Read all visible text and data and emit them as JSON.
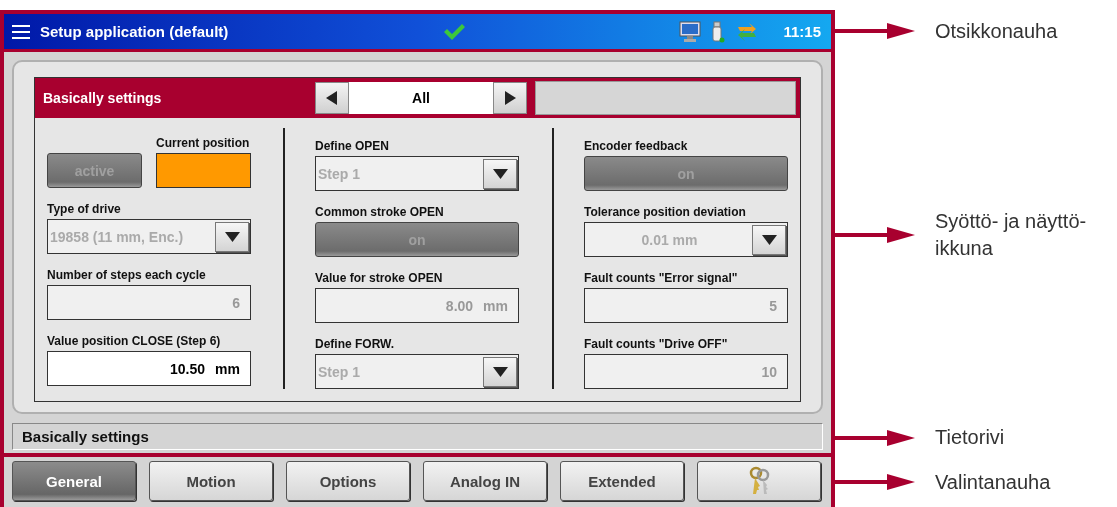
{
  "title_bar": {
    "title": "Setup application (default)",
    "time": "11:15"
  },
  "panel": {
    "title": "Basically settings",
    "filter": "All",
    "columns": [
      {
        "fields": [
          {
            "kind": "toggle-indicator",
            "text": "active",
            "disabled": true,
            "label": "Current position",
            "color": "#ff9900"
          },
          {
            "kind": "dropdown",
            "label": "Type of drive",
            "value": "19858 (11 mm, Enc.)",
            "disabled": true
          },
          {
            "kind": "number",
            "label": "Number of steps each cycle",
            "value": "6",
            "disabled": true
          },
          {
            "kind": "number",
            "label": "Value position CLOSE (Step 6)",
            "value": "10.50",
            "unit": "mm",
            "disabled": false
          }
        ]
      },
      {
        "fields": [
          {
            "kind": "dropdown",
            "label": "Define OPEN",
            "value": "Step 1",
            "disabled": true
          },
          {
            "kind": "toggle",
            "label": "Common stroke OPEN",
            "text": "on",
            "disabled": true
          },
          {
            "kind": "number",
            "label": "Value for stroke OPEN",
            "value": "8.00",
            "unit": "mm",
            "disabled": true
          },
          {
            "kind": "dropdown",
            "label": "Define FORW.",
            "value": "Step 1",
            "disabled": true
          }
        ]
      },
      {
        "fields": [
          {
            "kind": "toggle",
            "label": "Encoder feedback",
            "text": "on",
            "disabled": true
          },
          {
            "kind": "dropdown",
            "label": "Tolerance position deviation",
            "value": "0.01 mm",
            "centered": true,
            "disabled": true
          },
          {
            "kind": "number",
            "label": "Fault counts \"Error signal\"",
            "value": "5",
            "disabled": true
          },
          {
            "kind": "number",
            "label": "Fault counts \"Drive OFF\"",
            "value": "10",
            "disabled": true
          }
        ]
      }
    ]
  },
  "info_row": {
    "text": "Basically settings"
  },
  "tabs": [
    {
      "kind": "text",
      "label": "General",
      "selected": true
    },
    {
      "kind": "text",
      "label": "Motion",
      "selected": false
    },
    {
      "kind": "text",
      "label": "Options",
      "selected": false
    },
    {
      "kind": "text",
      "label": "Analog IN",
      "selected": false
    },
    {
      "kind": "text",
      "label": "Extended",
      "selected": false
    },
    {
      "kind": "icon",
      "selected": false
    }
  ],
  "annotations": [
    "Otsikkonauha",
    "Syöttö- ja näyttö-\nikkuna",
    "Tietorivi",
    "Valintanauha"
  ]
}
